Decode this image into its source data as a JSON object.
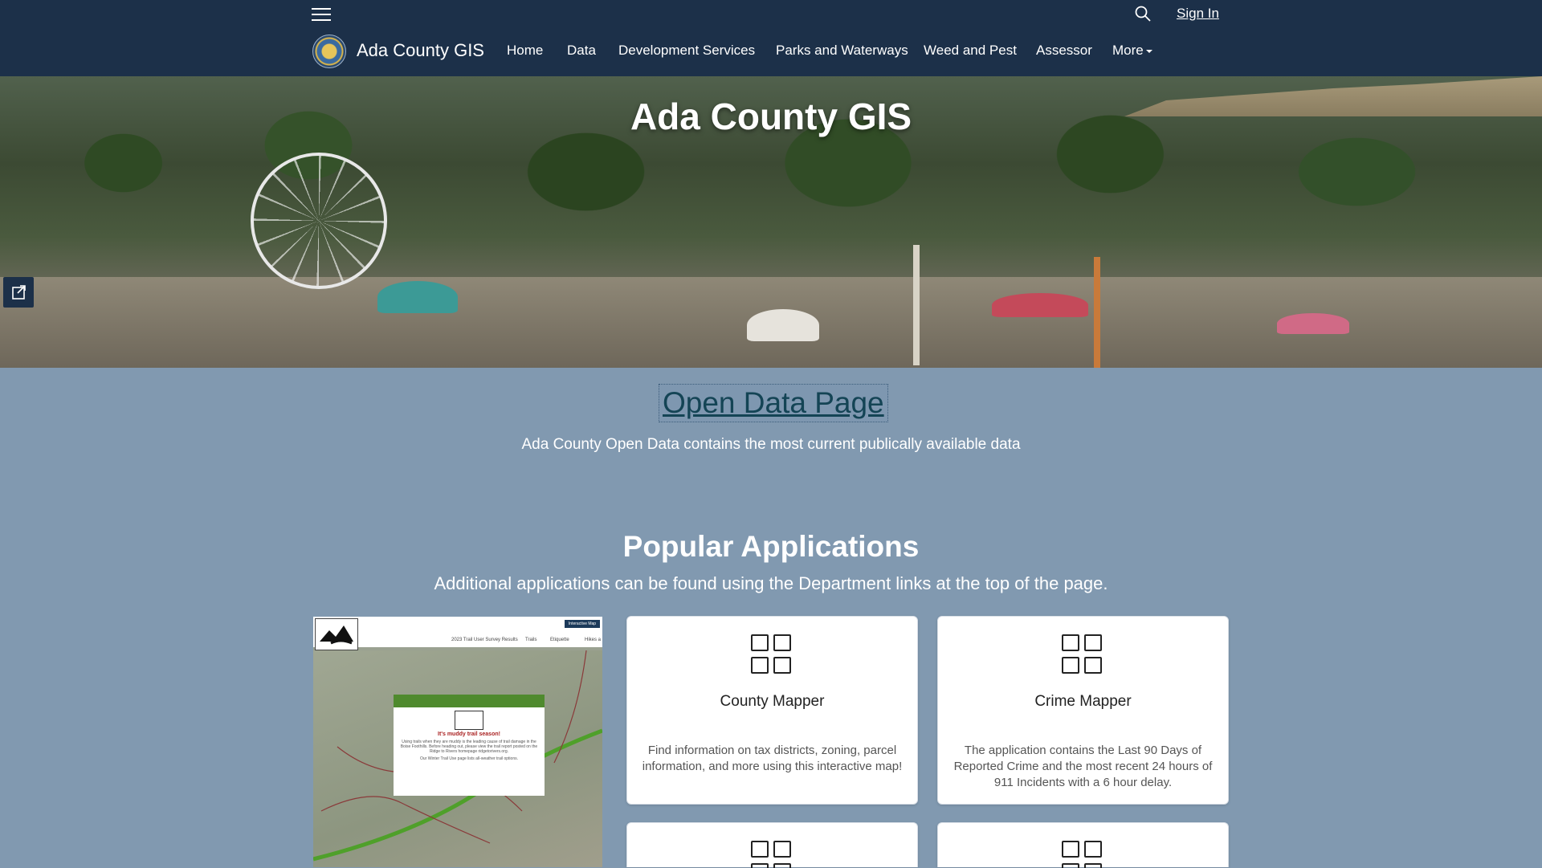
{
  "header": {
    "site_title": "Ada County GIS",
    "sign_in_label": "Sign In",
    "nav": [
      {
        "label": "Home"
      },
      {
        "label": "Data"
      },
      {
        "label": "Development Services"
      },
      {
        "label": "Parks and Waterways"
      },
      {
        "label": "Weed and Pest"
      },
      {
        "label": "Assessor"
      },
      {
        "label": "More"
      }
    ]
  },
  "hero": {
    "title": "Ada County GIS"
  },
  "open_data": {
    "link_label": "Open Data Page",
    "description": "Ada County Open Data contains the most current publically available data"
  },
  "popular": {
    "title": "Popular Applications",
    "subtitle": "Additional applications can be found using the Department links at the top of the page.",
    "thumbnail": {
      "heading": "2023 Trail User Survey Results",
      "menu_trails": "Trails",
      "menu_etiquette": "Etiquette",
      "menu_hikes": "Hikes a",
      "button": "Interactive Map",
      "popup_title": "It's muddy trail season!",
      "popup_text": "Using trails when they are muddy is the leading cause of trail damage in the Boise Foothills. Before heading out, please view the trail report posted on the Ridge to Rivers homepage ridgetorivers.org.",
      "popup_text2": "Our Winter Trail Use page lists all-weather trail options."
    },
    "cards": [
      {
        "title": "County Mapper",
        "description": "Find information on tax districts, zoning, parcel information, and more using this interactive map!"
      },
      {
        "title": "Crime Mapper",
        "description": "The application contains the Last 90 Days of Reported Crime and the most recent 24 hours of 911 Incidents with a 6 hour delay."
      }
    ]
  },
  "colors": {
    "header_bg": "#1c3049",
    "page_bg": "#8199b0",
    "link": "#144455"
  }
}
